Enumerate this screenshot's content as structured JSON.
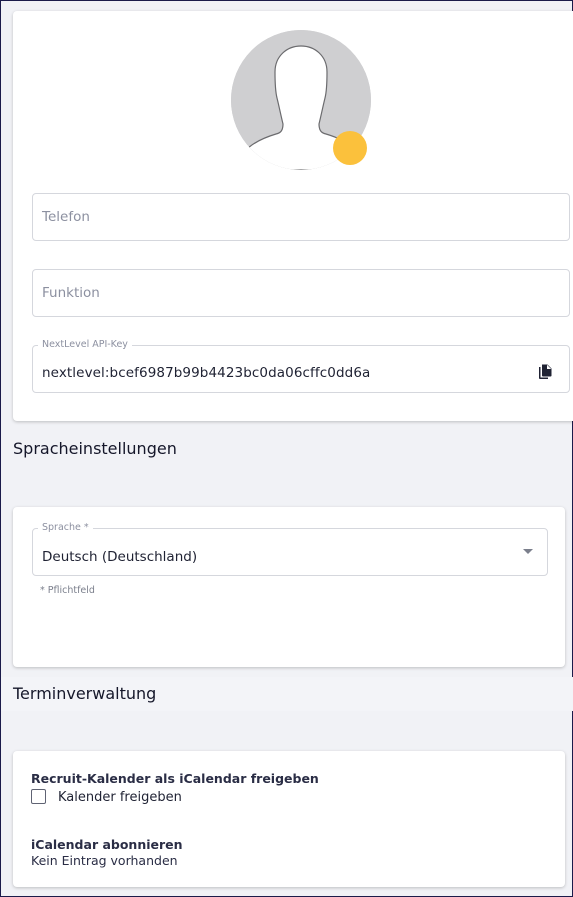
{
  "profile": {
    "phone_placeholder": "Telefon",
    "function_placeholder": "Funktion",
    "api_key_label": "NextLevel API-Key",
    "api_key_value": "nextlevel:bcef6987b99b4423bc0da06cffc0dd6a",
    "badge_color": "#fbc13c"
  },
  "language_section": {
    "title": "Spracheinstellungen",
    "field_label": "Sprache *",
    "selected_value": "Deutsch (Deutschland)",
    "required_note": "* Pflichtfeld"
  },
  "appointments_section": {
    "title": "Terminverwaltung",
    "share_heading": "Recruit-Kalender als iCalendar freigeben",
    "share_checkbox_label": "Kalender freigeben",
    "share_checked": false,
    "subscribe_heading": "iCalendar abonnieren",
    "subscribe_empty": "Kein Eintrag vorhanden"
  }
}
